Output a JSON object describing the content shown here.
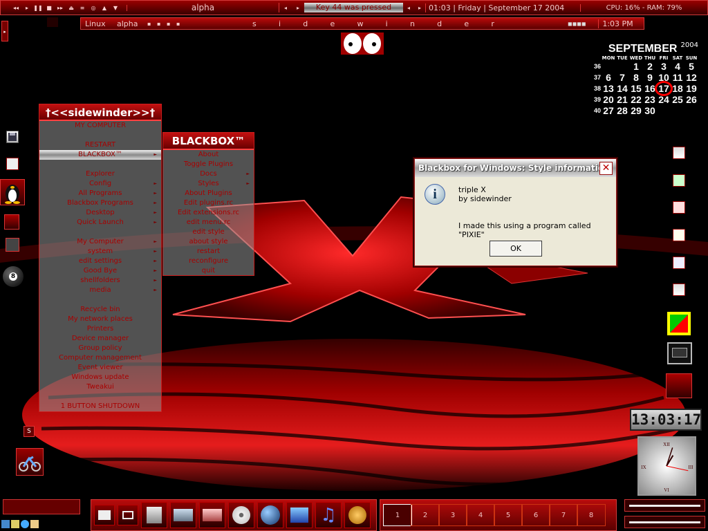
{
  "top": {
    "workspace": "alpha",
    "key_message": "Key 44 was pressed",
    "clock_text": "01:03 | Friday |  September 17 2004",
    "sysmon": "CPU: 16% - RAM: 79%",
    "media_buttons": [
      "◂◂",
      "▸",
      "❚❚",
      "■",
      "▸▸",
      "⏏",
      "≡",
      "◎",
      "▲",
      "▼"
    ]
  },
  "second": {
    "items": [
      "Linux",
      "alpha"
    ],
    "spaced_title": [
      "s",
      "i",
      "d",
      "e",
      "w",
      "i",
      "n",
      "d",
      "e",
      "r"
    ],
    "time": "1:03 PM"
  },
  "main_menu": {
    "title": "†<<sidewinder>>†",
    "items": [
      {
        "label": "MY COMPUTER",
        "sub": false
      },
      {
        "label": "",
        "sub": false
      },
      {
        "label": "RESTART",
        "sub": false
      },
      {
        "label": "BLACKBOX™",
        "sub": true,
        "sel": true
      },
      {
        "label": "",
        "sub": false
      },
      {
        "label": "Explorer",
        "sub": false
      },
      {
        "label": "Config",
        "sub": true
      },
      {
        "label": "All Programs",
        "sub": true
      },
      {
        "label": "Blackbox Programs",
        "sub": true
      },
      {
        "label": "Desktop",
        "sub": true
      },
      {
        "label": "Quick Launch",
        "sub": true
      },
      {
        "label": "",
        "sub": false
      },
      {
        "label": "My Computer",
        "sub": true
      },
      {
        "label": "system",
        "sub": true
      },
      {
        "label": "edit settings",
        "sub": true
      },
      {
        "label": "Good Bye",
        "sub": true
      },
      {
        "label": "shellfolders",
        "sub": true
      },
      {
        "label": "media",
        "sub": true
      },
      {
        "label": "",
        "sub": false
      },
      {
        "label": "Recycle bin",
        "sub": false
      },
      {
        "label": "My network places",
        "sub": false
      },
      {
        "label": "Printers",
        "sub": false
      },
      {
        "label": "Device manager",
        "sub": false
      },
      {
        "label": "Group policy",
        "sub": false
      },
      {
        "label": "Computer management",
        "sub": false
      },
      {
        "label": "Event viewer",
        "sub": false
      },
      {
        "label": "Windows update",
        "sub": false
      },
      {
        "label": "Tweakui",
        "sub": false
      },
      {
        "label": "",
        "sub": false
      },
      {
        "label": "1 BUTTON SHUTDOWN",
        "sub": false
      }
    ]
  },
  "blackbox_menu": {
    "title": "BLACKBOX™",
    "items": [
      {
        "label": "About",
        "sub": false
      },
      {
        "label": "Toggle Plugins",
        "sub": false
      },
      {
        "label": "Docs",
        "sub": true
      },
      {
        "label": "Styles",
        "sub": true
      },
      {
        "label": "About Plugins",
        "sub": false
      },
      {
        "label": "Edit plugins.rc",
        "sub": false
      },
      {
        "label": "Edit extensions.rc",
        "sub": false
      },
      {
        "label": "edit menu.rc",
        "sub": false
      },
      {
        "label": "edit style",
        "sub": false
      },
      {
        "label": "about style",
        "sub": false
      },
      {
        "label": "restart",
        "sub": false
      },
      {
        "label": "reconfigure",
        "sub": false
      },
      {
        "label": "quit",
        "sub": false
      }
    ]
  },
  "dialog": {
    "title": "Blackbox for Windows: Style information",
    "line1": "triple X",
    "line2": "by sidewinder",
    "line3": "I made this using a program called \"PIXIE\"",
    "ok": "OK"
  },
  "calendar": {
    "month": "SEPTEMBER",
    "year": "2004",
    "days": [
      "MON",
      "TUE",
      "WED",
      "THU",
      "FRI",
      "SAT",
      "SUN"
    ],
    "weeks": [
      {
        "wk": "36",
        "d": [
          "",
          "",
          "1",
          "2",
          "3",
          "4",
          "5"
        ]
      },
      {
        "wk": "37",
        "d": [
          "6",
          "7",
          "8",
          "9",
          "10",
          "11",
          "12"
        ]
      },
      {
        "wk": "38",
        "d": [
          "13",
          "14",
          "15",
          "16",
          "17",
          "18",
          "19"
        ]
      },
      {
        "wk": "39",
        "d": [
          "20",
          "21",
          "22",
          "23",
          "24",
          "25",
          "26"
        ]
      },
      {
        "wk": "40",
        "d": [
          "27",
          "28",
          "29",
          "30",
          "",
          "",
          ""
        ]
      }
    ],
    "today": "17",
    "today_color": "#ff0000"
  },
  "digital_clock": "13:03:17",
  "analog_clock": {
    "hour": 1,
    "minute": 3,
    "second": 17,
    "numerals": [
      "XII",
      "III",
      "VI",
      "IX"
    ]
  },
  "left_s": "S",
  "workspaces": [
    "1",
    "2",
    "3",
    "4",
    "5",
    "6",
    "7",
    "8"
  ],
  "accent": "#cc0000",
  "icons": {
    "left": [
      "floppy-icon",
      "folder-icon",
      "tux-icon",
      "red-square-icon",
      "disk-icon",
      "eight-ball-icon",
      "motorbike-icon"
    ],
    "right": [
      "word-icon",
      "excel-icon",
      "app-icon",
      "notepad-icon",
      "paint-icon",
      "doc-icon",
      "gradient-square-icon",
      "terminal-icon",
      "red-square-icon"
    ],
    "taskbar": [
      "photo-icon",
      "window-icon",
      "pc-icon",
      "drive-icon",
      "drive-icon",
      "cd-icon",
      "globe-icon",
      "network-icon",
      "music-icon",
      "media-player-icon"
    ]
  }
}
